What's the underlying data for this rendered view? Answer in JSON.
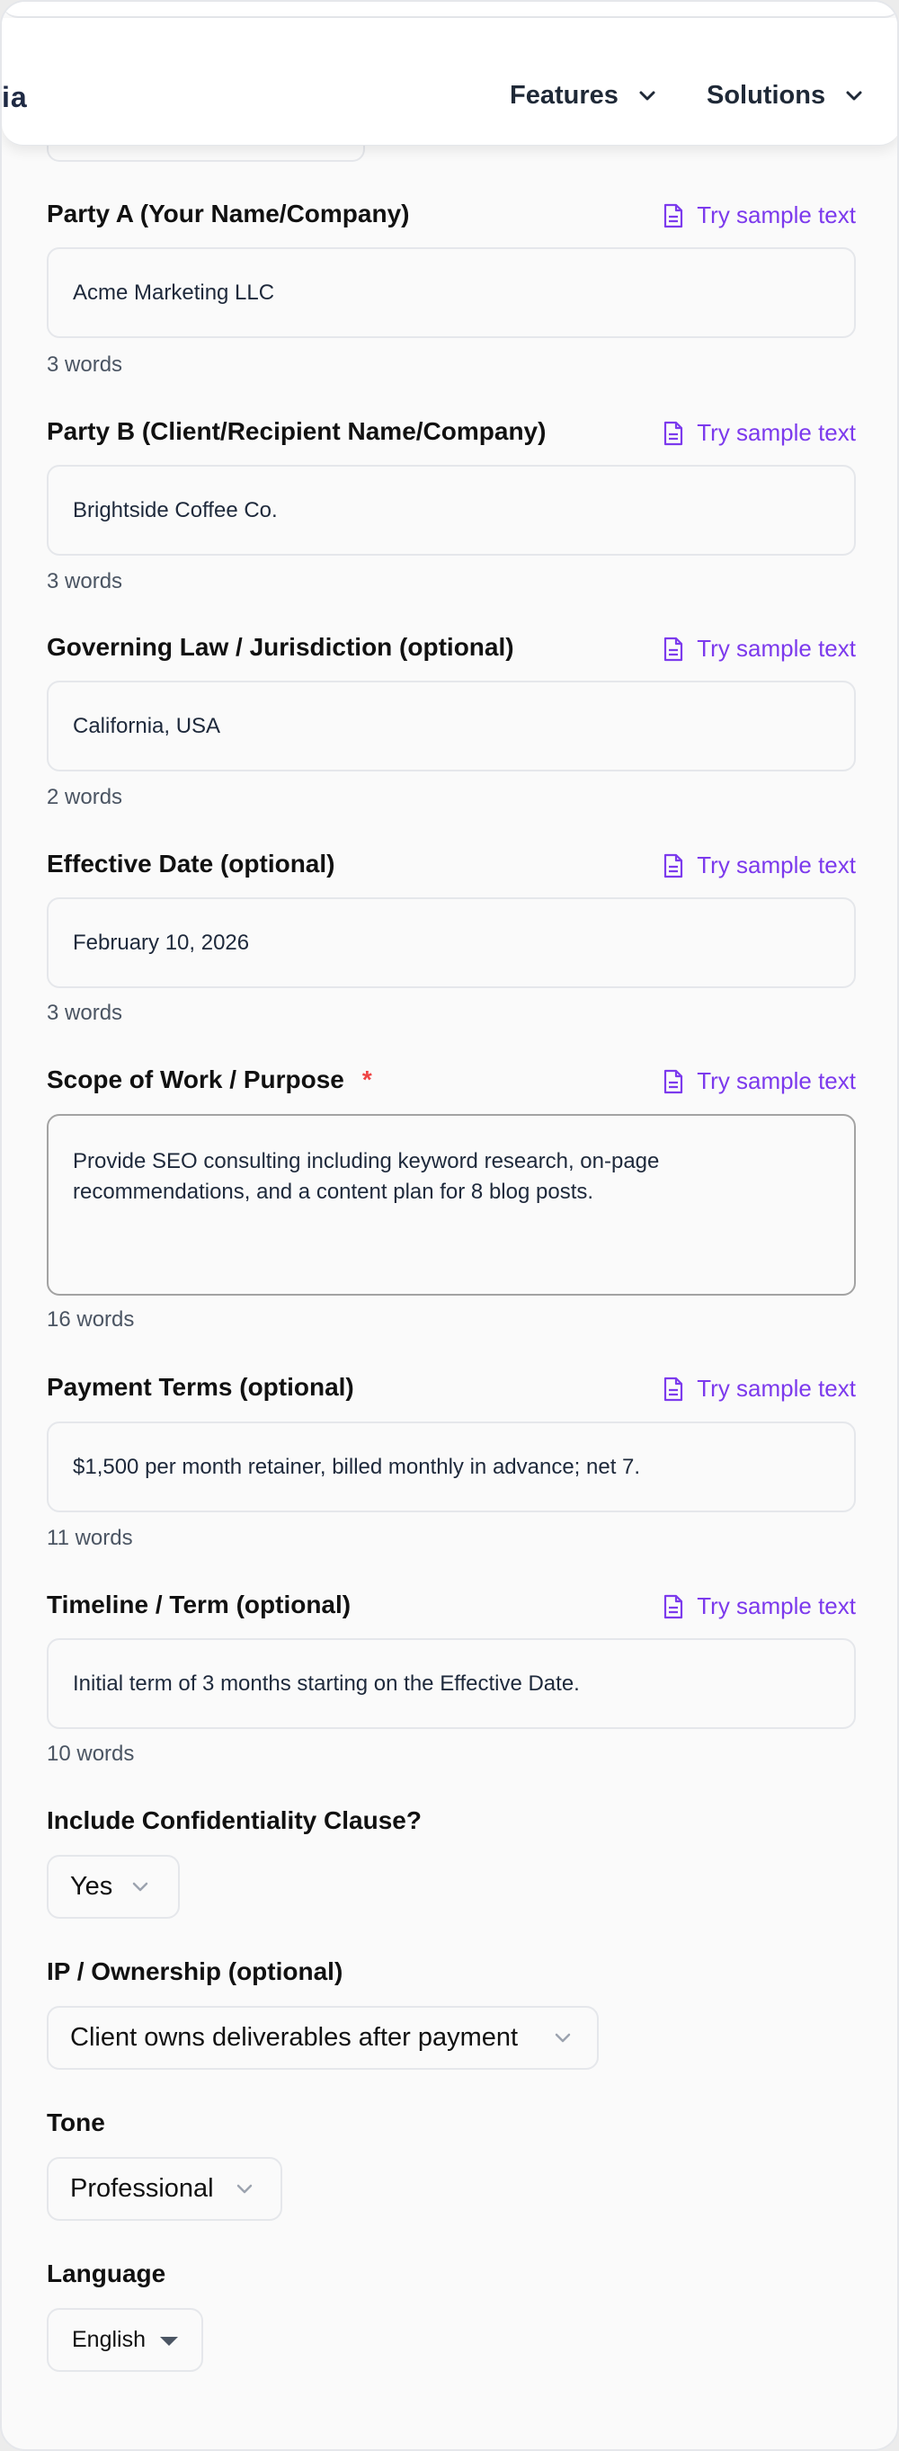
{
  "nav": {
    "brand_fragment": "ia",
    "items": [
      {
        "label": "Features"
      },
      {
        "label": "Solutions"
      }
    ]
  },
  "sample_link_label": "Try sample text",
  "fields": {
    "party_a": {
      "label": "Party A (Your Name/Company)",
      "value": "Acme Marketing LLC",
      "word_count": "3 words"
    },
    "party_b": {
      "label": "Party B (Client/Recipient Name/Company)",
      "value": "Brightside Coffee Co.",
      "word_count": "3 words"
    },
    "governing_law": {
      "label": "Governing Law / Jurisdiction (optional)",
      "value": "California, USA",
      "word_count": "2 words"
    },
    "effective_date": {
      "label": "Effective Date (optional)",
      "value": "February 10, 2026",
      "word_count": "3 words"
    },
    "scope": {
      "label": "Scope of Work / Purpose",
      "required_mark": "*",
      "value": "Provide SEO consulting including keyword research, on-page recommendations, and a content plan for 8 blog posts.",
      "word_count": "16 words"
    },
    "payment_terms": {
      "label": "Payment Terms (optional)",
      "value": "$1,500 per month retainer, billed monthly in advance; net 7.",
      "word_count": "11 words"
    },
    "timeline": {
      "label": "Timeline / Term (optional)",
      "value": "Initial term of 3 months starting on the Effective Date.",
      "word_count": "10 words"
    }
  },
  "selects": {
    "confidentiality": {
      "label": "Include Confidentiality Clause?",
      "value": "Yes"
    },
    "ip_ownership": {
      "label": "IP / Ownership (optional)",
      "value": "Client owns deliverables after payment"
    },
    "tone": {
      "label": "Tone",
      "value": "Professional"
    },
    "language": {
      "label": "Language",
      "value": "English"
    }
  },
  "colors": {
    "accent": "#7c3aed",
    "required": "#ef4444",
    "label": "#111111",
    "muted": "#4b5563"
  }
}
